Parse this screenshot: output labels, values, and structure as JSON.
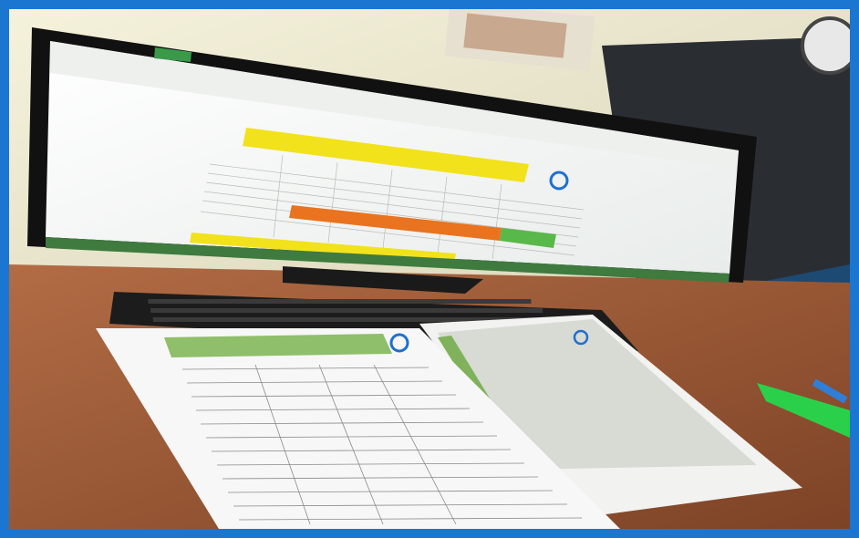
{
  "frame": {
    "border_color": "#1b76d1"
  },
  "scene": {
    "subject": "photo",
    "colors": {
      "wall": "#e8e4c9",
      "desk": "#9a5a38",
      "monitor_bezel": "#111111",
      "screen_bg": "#f4f6ef",
      "spreadsheet_header_yellow": "#f2e21c",
      "spreadsheet_orange_band": "#e9731f",
      "spreadsheet_green_cell": "#59b84a",
      "paper": "#f7f7f7",
      "paper_green_header": "#8fbf6a",
      "keyboard": "#1c1c1c",
      "logo_blue": "#1f6fd0"
    },
    "icons": [
      "monitor",
      "keyboard",
      "paper-sheet",
      "spreadsheet",
      "recycle-logo"
    ]
  }
}
